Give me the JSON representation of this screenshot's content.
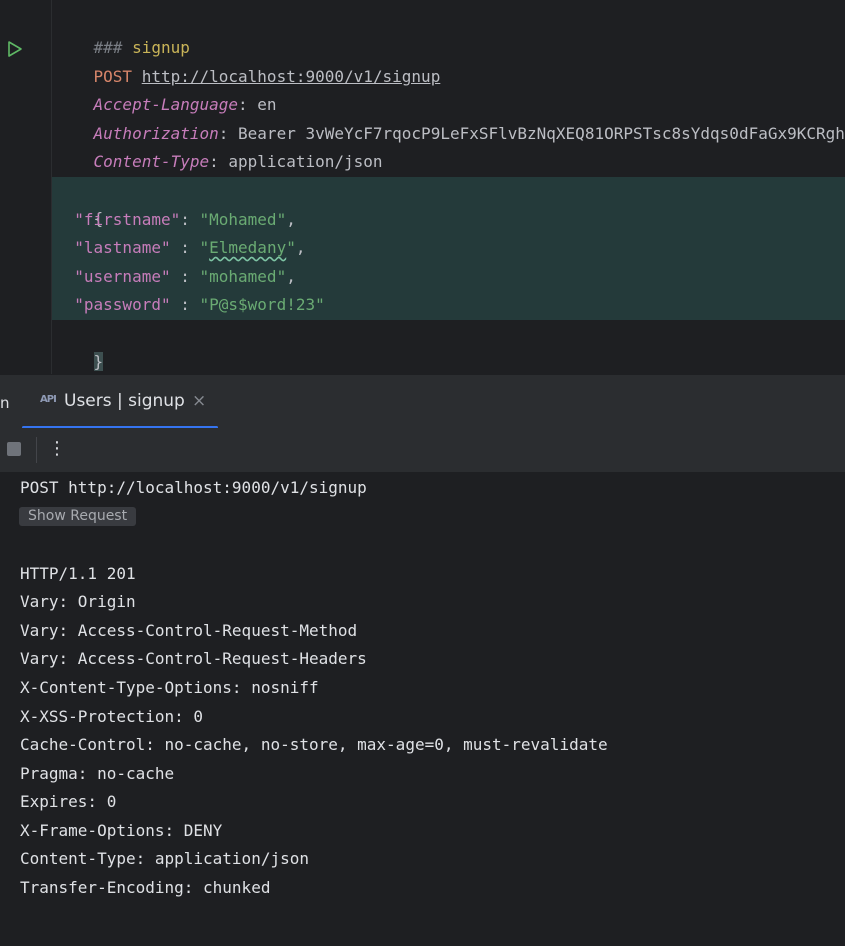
{
  "editor": {
    "comment_marker": "###",
    "comment_text": "signup",
    "method": "POST",
    "url": "http://localhost:9000/v1/signup",
    "headers": [
      {
        "key": "Accept-Language",
        "value": "en"
      },
      {
        "key": "Authorization",
        "value": "Bearer 3vWeYcF7rqocP9LeFxSFlvBzNqXEQ81ORPSTsc8sYdqs0dFaGx9KCRgh"
      },
      {
        "key": "Content-Type",
        "value": "application/json"
      }
    ],
    "body_open": "{",
    "body_close": "}",
    "body_fields": [
      {
        "key": "\"firstname\"",
        "sep": ": ",
        "value": "\"Mohamed\"",
        "trail": ","
      },
      {
        "key": "\"lastname\"",
        "sep": " : ",
        "value_q1": "\"",
        "value_word": "Elmedany",
        "value_q2": "\"",
        "trail": ","
      },
      {
        "key": "\"username\"",
        "sep": " : ",
        "value": "\"mohamed\"",
        "trail": ","
      },
      {
        "key": "\"password\"",
        "sep": " : ",
        "value": "\"P@s$word!23\"",
        "trail": ""
      }
    ]
  },
  "tool_window": {
    "left_edge_text": "n",
    "tab": {
      "icon_text": "API",
      "label": "Users | signup",
      "close": "×"
    },
    "toolbar": {
      "more": "⋮"
    }
  },
  "response": {
    "request_line": "POST http://localhost:9000/v1/signup",
    "show_request_label": "Show Request",
    "status_line": "HTTP/1.1 201",
    "headers": [
      "Vary: Origin",
      "Vary: Access-Control-Request-Method",
      "Vary: Access-Control-Request-Headers",
      "X-Content-Type-Options: nosniff",
      "X-XSS-Protection: 0",
      "Cache-Control: no-cache, no-store, max-age=0, must-revalidate",
      "Pragma: no-cache",
      "Expires: 0",
      "X-Frame-Options: DENY",
      "Content-Type: application/json",
      "Transfer-Encoding: chunked"
    ]
  },
  "colors": {
    "background": "#1e1f22",
    "panel": "#2b2d30",
    "accent": "#3574f0",
    "string": "#6aab73",
    "header_key": "#c77dbb",
    "method": "#d6856a"
  }
}
